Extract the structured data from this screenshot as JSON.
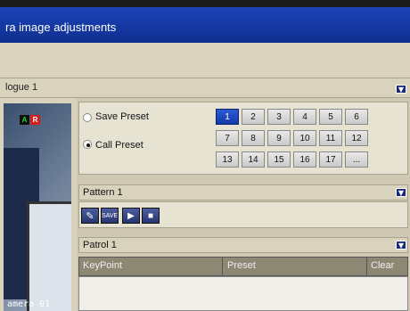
{
  "window": {
    "title": "ra image adjustments"
  },
  "camera_select": {
    "value": "logue 1"
  },
  "video": {
    "camera_label": "amera 01",
    "badge_a": "A",
    "badge_r": "R"
  },
  "preset": {
    "save_label": "Save Preset",
    "call_label": "Call Preset",
    "selected_option": "call",
    "numbers": [
      "1",
      "2",
      "3",
      "4",
      "5",
      "6",
      "7",
      "8",
      "9",
      "10",
      "11",
      "12",
      "13",
      "14",
      "15",
      "16",
      "17",
      "..."
    ],
    "selected_number": "1"
  },
  "pattern": {
    "value": "Pattern 1",
    "save_label": "SAVE"
  },
  "patrol": {
    "value": "Patrol 1",
    "columns": [
      "KeyPoint",
      "Preset",
      "Clear"
    ]
  },
  "icons": {
    "dropdown": "chevron-down-icon",
    "edit": "pencil-icon",
    "play": "play-icon",
    "stop": "stop-icon"
  },
  "colors": {
    "title_bar": "#1c44b8",
    "selected": "#1238a8",
    "panel": "#d9d3bd"
  }
}
